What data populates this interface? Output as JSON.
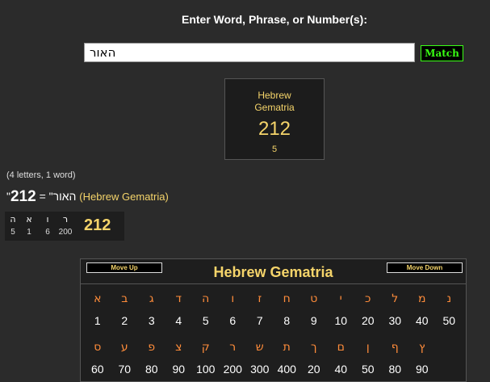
{
  "prompt": "Enter Word, Phrase, or Number(s):",
  "search": {
    "value": "האור"
  },
  "match_button": "Match",
  "result_card": {
    "label_line1": "Hebrew",
    "label_line2": "Gematria",
    "value": "212",
    "count": "5"
  },
  "summary": "(4 letters, 1 word)",
  "equation": {
    "word": "\"האור\"",
    "equals": " = ",
    "value": "212",
    "cipher": "(Hebrew Gematria)"
  },
  "breakdown": {
    "letters": [
      "ה",
      "א",
      "ו",
      "ר"
    ],
    "values": [
      "5",
      "1",
      "6",
      "200"
    ],
    "total": "212"
  },
  "table": {
    "title": "Hebrew Gematria",
    "move_up": "Move Up",
    "move_down": "Move Down",
    "row1_letters": [
      "א",
      "ב",
      "ג",
      "ד",
      "ה",
      "ו",
      "ז",
      "ח",
      "ט",
      "י",
      "כ",
      "ל",
      "מ",
      "נ"
    ],
    "row1_values": [
      "1",
      "2",
      "3",
      "4",
      "5",
      "6",
      "7",
      "8",
      "9",
      "10",
      "20",
      "30",
      "40",
      "50"
    ],
    "row2_letters": [
      "ס",
      "ע",
      "פ",
      "צ",
      "ק",
      "ר",
      "ש",
      "ת",
      "ך",
      "ם",
      "ן",
      "ף",
      "ץ"
    ],
    "row2_values": [
      "60",
      "70",
      "80",
      "90",
      "100",
      "200",
      "300",
      "400",
      "20",
      "40",
      "50",
      "80",
      "90"
    ]
  },
  "colors": {
    "accent": "#f5d46a",
    "letter": "#ff8c3a",
    "match": "#39ff14",
    "background": "#2b2b2b"
  }
}
